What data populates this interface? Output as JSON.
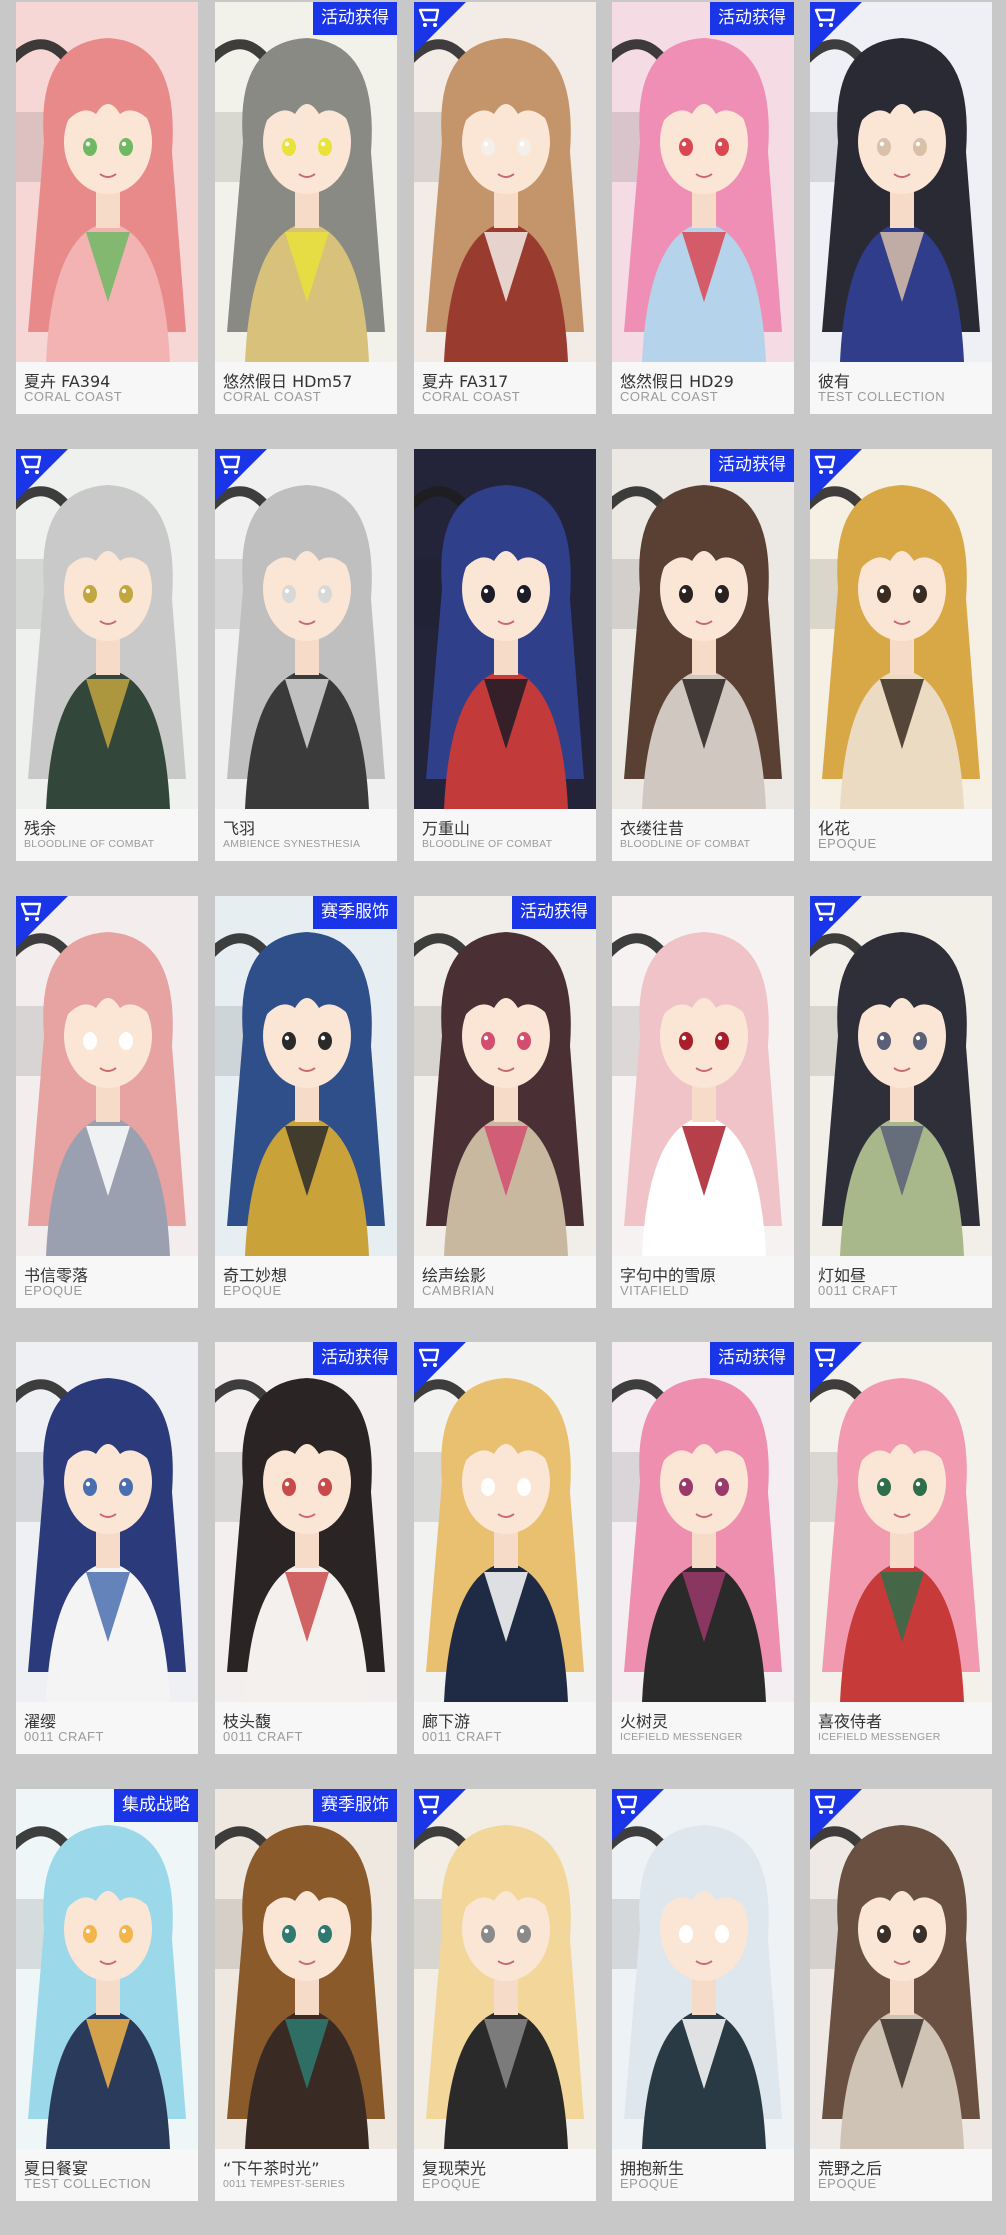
{
  "colors": {
    "badge_blue": "#1a34e8",
    "page_bg": "#c8c8c8",
    "name_text": "#333333",
    "series_text": "#9a9a9a"
  },
  "cards": [
    {
      "name": "夏卉 FA394",
      "series": "CORAL COAST",
      "badge": "",
      "corner": false,
      "art": [
        "#f7d6d6",
        "#e98a8a",
        "#f4b3b3",
        "#6fb864"
      ]
    },
    {
      "name": "悠然假日 HDm57",
      "series": "CORAL COAST",
      "badge": "活动获得",
      "corner": false,
      "art": [
        "#f2f2ea",
        "#8a8a84",
        "#d8c17a",
        "#e8e23a"
      ]
    },
    {
      "name": "夏卉 FA317",
      "series": "CORAL COAST",
      "badge": "",
      "corner": true,
      "art": [
        "#f3ebe6",
        "#c4956b",
        "#9a3b2f",
        "#f4efe9"
      ]
    },
    {
      "name": "悠然假日 HD29",
      "series": "CORAL COAST",
      "badge": "活动获得",
      "corner": false,
      "art": [
        "#f4dbe4",
        "#f08fb5",
        "#b5d3ea",
        "#d94752"
      ]
    },
    {
      "name": "彼有",
      "series": "TEST COLLECTION",
      "badge": "",
      "corner": true,
      "art": [
        "#eef0f6",
        "#2a2a34",
        "#2f3d8a",
        "#d9c0a8"
      ]
    },
    {
      "name": "残余",
      "series": "BLOODLINE OF COMBAT",
      "badge": "",
      "corner": true,
      "art": [
        "#eef1ee",
        "#c9c9c9",
        "#33463a",
        "#c2a640"
      ]
    },
    {
      "name": "飞羽",
      "series": "AMBIENCE SYNESTHESIA",
      "badge": "",
      "corner": true,
      "art": [
        "#f0f0f0",
        "#bfbfbf",
        "#3a3a3a",
        "#d8d8d8"
      ]
    },
    {
      "name": "万重山",
      "series": "BLOODLINE OF COMBAT",
      "badge": "",
      "corner": false,
      "art": [
        "#23233a",
        "#2f3f8a",
        "#c23a3a",
        "#1c1c28"
      ]
    },
    {
      "name": "衣缕往昔",
      "series": "BLOODLINE OF COMBAT",
      "badge": "活动获得",
      "corner": false,
      "art": [
        "#ece8e4",
        "#5a4032",
        "#cfc7c0",
        "#2a2220"
      ]
    },
    {
      "name": "化花",
      "series": "EPOQUE",
      "badge": "",
      "corner": true,
      "art": [
        "#f5efe4",
        "#d9a846",
        "#eadbc2",
        "#3a2c20"
      ]
    },
    {
      "name": "书信零落",
      "series": "EPOQUE",
      "badge": "",
      "corner": true,
      "art": [
        "#f3eded",
        "#e7a2a2",
        "#9aa0b0",
        "#ffffff"
      ]
    },
    {
      "name": "奇工妙想",
      "series": "EPOQUE",
      "badge": "赛季服饰",
      "corner": false,
      "art": [
        "#e6eef2",
        "#2f4f8a",
        "#c9a23a",
        "#2a2a2a"
      ]
    },
    {
      "name": "绘声绘影",
      "series": "CAMBRIAN",
      "badge": "活动获得",
      "corner": false,
      "art": [
        "#f1ede8",
        "#4a2f34",
        "#c9b8a0",
        "#d24d6e"
      ]
    },
    {
      "name": "字句中的雪原",
      "series": "VITAFIELD",
      "badge": "",
      "corner": false,
      "art": [
        "#f7f2f2",
        "#f0c3c8",
        "#ffffff",
        "#a81e2a"
      ]
    },
    {
      "name": "灯如昼",
      "series": "0011 CRAFT",
      "badge": "",
      "corner": true,
      "art": [
        "#f2efe8",
        "#2f2f3a",
        "#a9b88a",
        "#5a6078"
      ]
    },
    {
      "name": "濯缨",
      "series": "0011 CRAFT",
      "badge": "",
      "corner": false,
      "art": [
        "#eef0f4",
        "#2a3a7a",
        "#f4f4f4",
        "#4a6fb0"
      ]
    },
    {
      "name": "枝头馥",
      "series": "0011 CRAFT",
      "badge": "活动获得",
      "corner": false,
      "art": [
        "#f2efee",
        "#2a2424",
        "#f4f0ee",
        "#c94a4a"
      ]
    },
    {
      "name": "廊下游",
      "series": "0011 CRAFT",
      "badge": "",
      "corner": true,
      "art": [
        "#f2f2f0",
        "#e8c070",
        "#1f2a44",
        "#ffffff"
      ]
    },
    {
      "name": "火树灵",
      "series": "ICEFIELD MESSENGER",
      "badge": "活动获得",
      "corner": false,
      "art": [
        "#f4eef2",
        "#ef8fb0",
        "#2a2a2a",
        "#9a3a6a"
      ]
    },
    {
      "name": "喜夜侍者",
      "series": "ICEFIELD MESSENGER",
      "badge": "",
      "corner": true,
      "art": [
        "#f4f0ea",
        "#f29ab0",
        "#c73a3a",
        "#2e6e4a"
      ]
    },
    {
      "name": "夏日餐宴",
      "series": "TEST COLLECTION",
      "badge": "集成战略",
      "corner": false,
      "art": [
        "#eef6f8",
        "#9ad8ea",
        "#2a3a5a",
        "#f3b54a"
      ]
    },
    {
      "name": "“下午茶时光”",
      "series": "0011 TEMPEST-SERIES",
      "badge": "赛季服饰",
      "corner": false,
      "art": [
        "#efe8e0",
        "#8a5a2a",
        "#3a2a24",
        "#2e7a70"
      ]
    },
    {
      "name": "复现荣光",
      "series": "EPOQUE",
      "badge": "",
      "corner": true,
      "art": [
        "#f2eee6",
        "#f2d69a",
        "#2a2a2a",
        "#8a8a8a"
      ]
    },
    {
      "name": "拥抱新生",
      "series": "EPOQUE",
      "badge": "",
      "corner": true,
      "art": [
        "#eef2f4",
        "#dfe7ee",
        "#2a3a44",
        "#ffffff"
      ]
    },
    {
      "name": "荒野之后",
      "series": "EPOQUE",
      "badge": "",
      "corner": true,
      "art": [
        "#eee9e4",
        "#6a5040",
        "#cfc3b5",
        "#3a302a"
      ]
    }
  ]
}
